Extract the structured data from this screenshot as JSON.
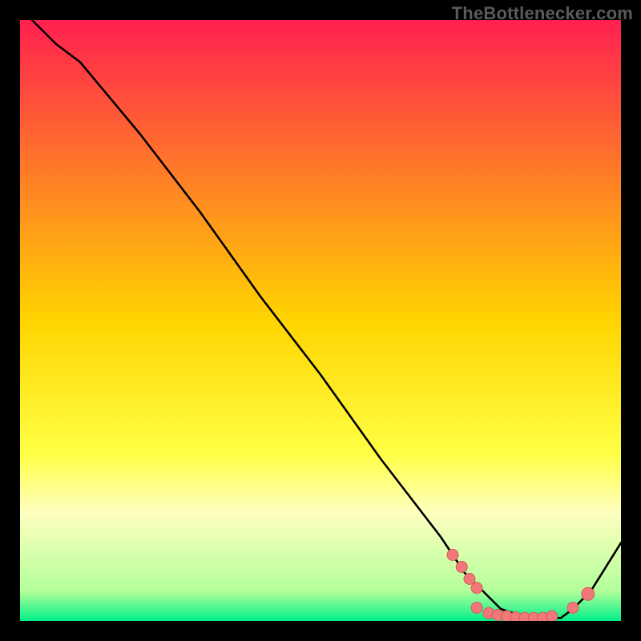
{
  "watermark": "TheBottlenecker.com",
  "chart_data": {
    "type": "line",
    "xlim": [
      0,
      100
    ],
    "ylim": [
      0,
      100
    ],
    "title": "",
    "xlabel": "",
    "ylabel": "",
    "grid": false,
    "background_gradient_stops": [
      {
        "offset": 0.0,
        "color": "#ff2050"
      },
      {
        "offset": 0.5,
        "color": "#ffd400"
      },
      {
        "offset": 0.72,
        "color": "#ffff44"
      },
      {
        "offset": 0.82,
        "color": "#ffffc0"
      },
      {
        "offset": 0.95,
        "color": "#b3ff9a"
      },
      {
        "offset": 1.0,
        "color": "#00ef8a"
      }
    ],
    "series": [
      {
        "name": "curve",
        "color": "#000000",
        "x": [
          2,
          6,
          10,
          20,
          30,
          40,
          50,
          60,
          70,
          74,
          78,
          80,
          83,
          86,
          90,
          92,
          95,
          100
        ],
        "y": [
          100,
          96,
          93,
          81,
          68,
          54,
          41,
          27,
          14,
          8,
          4,
          2,
          1,
          0.5,
          0.5,
          2,
          5,
          13
        ]
      }
    ],
    "markers": [
      {
        "x": 72.0,
        "y": 11.0,
        "r": 7
      },
      {
        "x": 73.5,
        "y": 9.0,
        "r": 7
      },
      {
        "x": 74.8,
        "y": 7.0,
        "r": 7
      },
      {
        "x": 76.0,
        "y": 5.5,
        "r": 7
      },
      {
        "x": 76.0,
        "y": 2.2,
        "r": 7
      },
      {
        "x": 78.0,
        "y": 1.3,
        "r": 7
      },
      {
        "x": 79.5,
        "y": 1.0,
        "r": 7
      },
      {
        "x": 81.0,
        "y": 0.8,
        "r": 7
      },
      {
        "x": 82.5,
        "y": 0.6,
        "r": 7
      },
      {
        "x": 84.0,
        "y": 0.5,
        "r": 7
      },
      {
        "x": 85.5,
        "y": 0.5,
        "r": 7
      },
      {
        "x": 87.0,
        "y": 0.5,
        "r": 7
      },
      {
        "x": 88.5,
        "y": 0.8,
        "r": 7
      },
      {
        "x": 92.0,
        "y": 2.2,
        "r": 7
      },
      {
        "x": 94.5,
        "y": 4.5,
        "r": 8
      }
    ],
    "marker_style": {
      "fill": "#f07878",
      "stroke": "#d85a5a"
    }
  }
}
